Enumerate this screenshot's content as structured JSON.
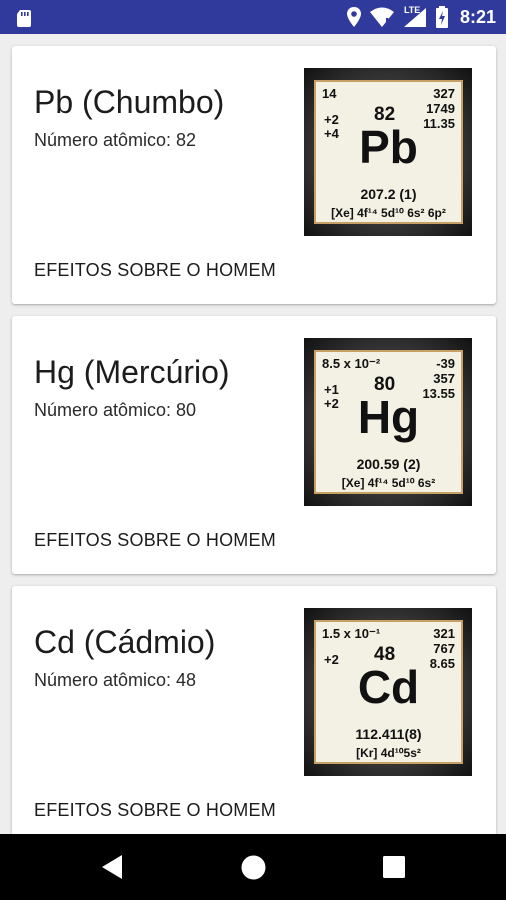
{
  "status_bar": {
    "time": "8:21",
    "network_label": "LTE"
  },
  "cards": [
    {
      "title": "Pb (Chumbo)",
      "subtitle": "Número atômico: 82",
      "action": "EFEITOS SOBRE O HOMEM",
      "tile": {
        "top_left": "14",
        "oxidation": [
          "+2",
          "+4"
        ],
        "number": "82",
        "right": [
          "327",
          "1749",
          "11.35"
        ],
        "symbol": "Pb",
        "mass": "207.2 (1)",
        "config": "[Xe] 4f¹⁴ 5d¹⁰ 6s² 6p²"
      }
    },
    {
      "title": "Hg (Mercúrio)",
      "subtitle": "Número atômico: 80",
      "action": "EFEITOS SOBRE O HOMEM",
      "tile": {
        "top_left": "8.5 x 10⁻²",
        "oxidation": [
          "+1",
          "+2"
        ],
        "number": "80",
        "right": [
          "-39",
          "357",
          "13.55"
        ],
        "symbol": "Hg",
        "mass": "200.59 (2)",
        "config": "[Xe] 4f¹⁴ 5d¹⁰ 6s²"
      }
    },
    {
      "title": "Cd (Cádmio)",
      "subtitle": "Número atômico: 48",
      "action": "EFEITOS SOBRE O HOMEM",
      "tile": {
        "top_left": "1.5 x 10⁻¹",
        "oxidation": [
          "+2",
          ""
        ],
        "number": "48",
        "right": [
          "321",
          "767",
          "8.65"
        ],
        "symbol": "Cd",
        "mass": "112.411(8)",
        "config": "[Kr] 4d¹⁰5s²"
      }
    }
  ],
  "colors": {
    "status_bar": "#2f3a9c",
    "background": "#eeeeee",
    "tile_border": "#c9a063"
  }
}
